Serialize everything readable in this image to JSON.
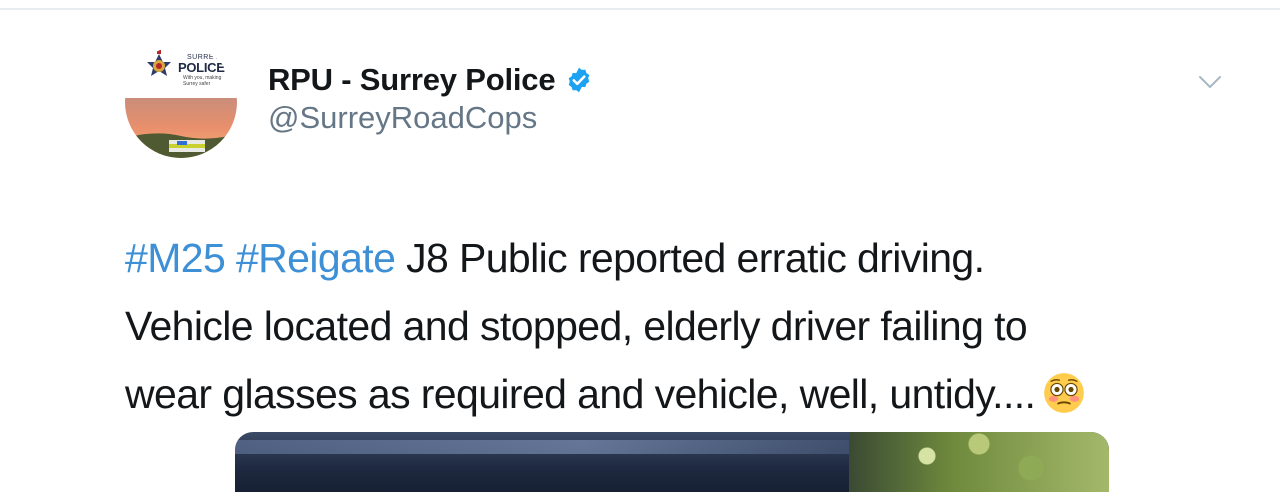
{
  "tweet": {
    "author": {
      "display_name": "RPU - Surrey Police",
      "handle": "@SurreyRoadCops",
      "verified_icon": "verified-badge-icon",
      "avatar": {
        "line1": "SURREY",
        "line2": "POLICE",
        "line3": "With you, making Surrey safer"
      }
    },
    "menu_icon": "chevron-down-icon",
    "text": {
      "hashtag1": "#M25",
      "hashtag2": "#Reigate",
      "line1_rest": " J8 Public reported erratic driving.",
      "line2": "Vehicle located and stopped, elderly driver failing to",
      "line3": "wear glasses as required and vehicle, well, untidy....",
      "emoji": "flushed-face-emoji"
    },
    "media": {
      "type": "photo"
    }
  },
  "colors": {
    "text": "#14171a",
    "secondary": "#657786",
    "link": "#3d8fd6",
    "verified": "#1da1f2",
    "divider": "#e6ecf0"
  }
}
